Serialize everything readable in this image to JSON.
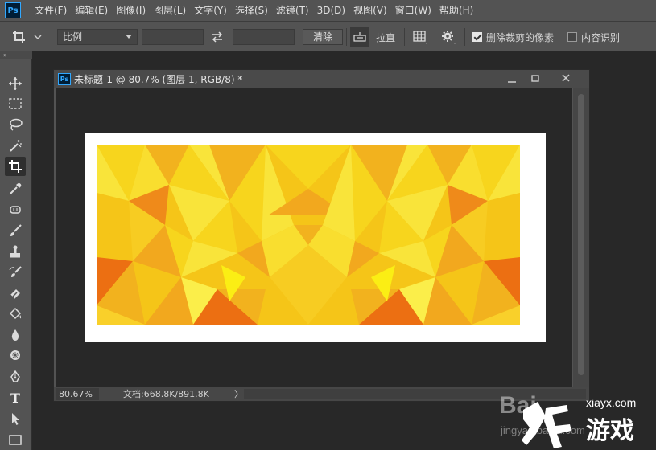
{
  "menu": {
    "app_logo": "Ps",
    "items": [
      "文件(F)",
      "编辑(E)",
      "图像(I)",
      "图层(L)",
      "文字(Y)",
      "选择(S)",
      "滤镜(T)",
      "3D(D)",
      "视图(V)",
      "窗口(W)",
      "帮助(H)"
    ]
  },
  "options": {
    "ratio_select": "比例",
    "width_value": "",
    "height_value": "",
    "clear_button": "清除",
    "straighten_label": "拉直",
    "delete_cropped_label": "删除裁剪的像素",
    "delete_cropped_checked": true,
    "content_aware_label": "内容识别",
    "content_aware_checked": false
  },
  "toolbar": {
    "grip": "»",
    "tools": [
      "move-tool",
      "marquee-tool",
      "lasso-tool",
      "magic-wand-tool",
      "crop-tool",
      "eyedropper-tool",
      "healing-tool",
      "brush-tool",
      "clone-stamp-tool",
      "history-brush-tool",
      "eraser-tool",
      "paint-bucket-tool",
      "blur-tool",
      "dodge-tool",
      "pen-tool",
      "type-tool",
      "path-select-tool",
      "rectangle-tool"
    ],
    "active_tool": "crop-tool",
    "type_glyph": "T"
  },
  "document": {
    "icon": "Ps",
    "title": "未标题-1 @ 80.7% (图层 1, RGB/8) *",
    "zoom": "80.67%",
    "doc_info": "文档:668.8K/891.8K",
    "status_arrow": "〉"
  },
  "watermark": {
    "text1": "Bai",
    "text2": "jingyan.baidu.com",
    "domain": "xiayx.com",
    "brand": "游戏"
  },
  "colors": {
    "accent": "#31a8ff",
    "panel": "#535353",
    "workspace": "#282828",
    "poly_yellows": [
      "#f5c518",
      "#f7d51d",
      "#f9e43a",
      "#f2a81e",
      "#ef8a1a",
      "#ec6f12",
      "#fbee4a"
    ]
  }
}
